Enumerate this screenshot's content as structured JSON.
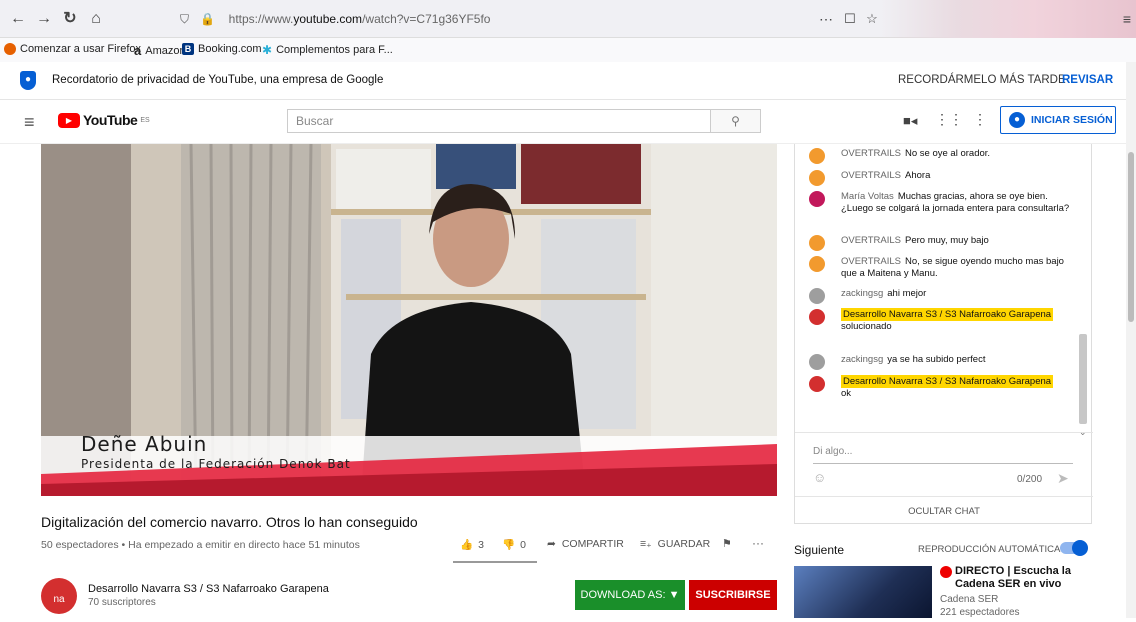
{
  "browser": {
    "url_prefix": "https://www.",
    "url_host": "youtube.com",
    "url_path": "/watch?v=C71g36YF5fo",
    "bookmarks": [
      {
        "label": "Comenzar a usar Firefox"
      },
      {
        "label": "Amazon"
      },
      {
        "label": "Booking.com"
      },
      {
        "label": "Complementos para F..."
      }
    ]
  },
  "privacy_banner": {
    "text": "Recordatorio de privacidad de YouTube, una empresa de Google",
    "later_label": "RECORDÁRMELO MÁS TARDE",
    "review_label": "REVISAR"
  },
  "header": {
    "logo_text": "YouTube",
    "logo_region": "ES",
    "search_placeholder": "Buscar",
    "signin_label": "INICIAR SESIÓN"
  },
  "video": {
    "lower_third_name": "Deñe Abuin",
    "lower_third_role": "Presidenta de la Federación Denok Bat",
    "title": "Digitalización del comercio navarro. Otros lo han conseguido",
    "meta": "50 espectadores • Ha empezado a emitir en directo hace 51 minutos",
    "likes": "3",
    "dislikes": "0",
    "share_label": "COMPARTIR",
    "save_label": "GUARDAR"
  },
  "channel": {
    "name": "Desarrollo Navarra S3 / S3 Nafarroako Garapena",
    "subscribers": "70 suscriptores",
    "avatar_text": "na",
    "download_label": "DOWNLOAD AS: ▼",
    "subscribe_label": "SUSCRIBIRSE"
  },
  "chat": {
    "messages": [
      {
        "author": "OVERTRAILS",
        "text": "No se oye al orador."
      },
      {
        "author": "OVERTRAILS",
        "text": "Ahora"
      },
      {
        "author": "María Voltas",
        "text": "Muchas gracias, ahora se oye bien. ¿Luego se colgará la jornada entera para consultarla?"
      },
      {
        "author": "OVERTRAILS",
        "text": "Pero muy, muy bajo"
      },
      {
        "author": "OVERTRAILS",
        "text": "No, se sigue oyendo mucho mas bajo que a Maitena y Manu."
      },
      {
        "author": "zackingsg",
        "text": "ahi mejor"
      },
      {
        "author": "Desarrollo Navarra S3 / S3 Nafarroako Garapena",
        "text": "solucionado"
      },
      {
        "author": "zackingsg",
        "text": "ya se ha subido perfect"
      },
      {
        "author": "Desarrollo Navarra S3 / S3 Nafarroako Garapena",
        "text": "ok"
      }
    ],
    "input_placeholder": "Di algo...",
    "char_count": "0/200",
    "hide_label": "OCULTAR CHAT"
  },
  "sidebar": {
    "next_label": "Siguiente",
    "autoplay_label": "REPRODUCCIÓN AUTOMÁTICA",
    "autoplay_on": true,
    "next_video": {
      "title": "DIRECTO | Escucha la Cadena SER en vivo",
      "channel": "Cadena SER",
      "viewers": "221 espectadores"
    }
  },
  "colors": {
    "youtube_red": "#ff0000",
    "subscribe_red": "#cc0000",
    "download_green": "#1a8f2a",
    "link_blue": "#065fd4",
    "highlight_yellow": "#ffd600"
  }
}
